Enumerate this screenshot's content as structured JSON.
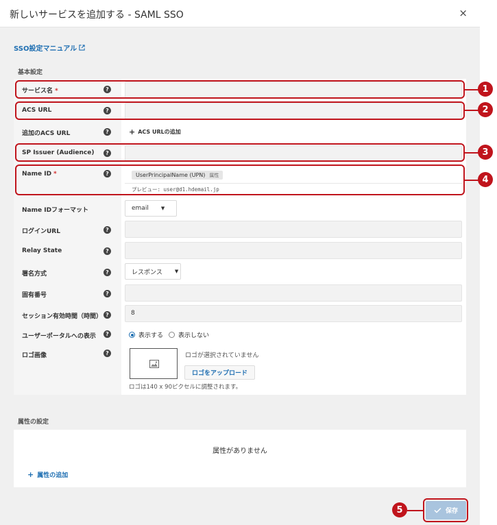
{
  "dialog": {
    "title": "新しいサービスを追加する - SAML SSO",
    "close_glyph": "×"
  },
  "manual_link": "SSO設定マニュアル",
  "basic_section_title": "基本設定",
  "required_mark": "*",
  "help_glyph": "?",
  "fields": {
    "service_name": {
      "label": "サービス名",
      "value": ""
    },
    "acs_url": {
      "label": "ACS URL",
      "value": ""
    },
    "additional_acs": {
      "label": "追加のACS URL",
      "action": "ACS URLの追加"
    },
    "sp_issuer": {
      "label": "SP Issuer (Audience)",
      "value": ""
    },
    "name_id": {
      "label": "Name ID",
      "tag": "UserPrincipalName (UPN)",
      "tag_badge": "属性",
      "preview": "プレビュー: user@d1.hdemail.jp"
    },
    "name_id_format": {
      "label": "Name IDフォーマット",
      "selected": "email"
    },
    "login_url": {
      "label": "ログインURL",
      "value": ""
    },
    "relay_state": {
      "label": "Relay State",
      "value": ""
    },
    "signature": {
      "label": "署名方式",
      "selected": "レスポンス"
    },
    "unique_number": {
      "label": "固有番号",
      "value": ""
    },
    "session_time": {
      "label": "セッション有効時間（時間）",
      "value": "8"
    },
    "portal_display": {
      "label": "ユーザーポータルへの表示",
      "options": [
        "表示する",
        "表示しない"
      ],
      "selected_index": 0
    },
    "logo": {
      "label": "ロゴ画像",
      "status": "ロゴが選択されていません",
      "upload": "ロゴをアップロード",
      "note": "ロゴは140 x 90ピクセルに調整されます。"
    }
  },
  "attributes_section": {
    "title": "属性の設定",
    "empty": "属性がありません",
    "add": "属性の追加"
  },
  "save_button": "保存",
  "callouts": [
    "1",
    "2",
    "3",
    "4",
    "5"
  ],
  "colors": {
    "accent": "#1f6fb2",
    "highlight": "#c0141c",
    "required": "#d32f2f",
    "save_disabled": "#a9c4de"
  }
}
